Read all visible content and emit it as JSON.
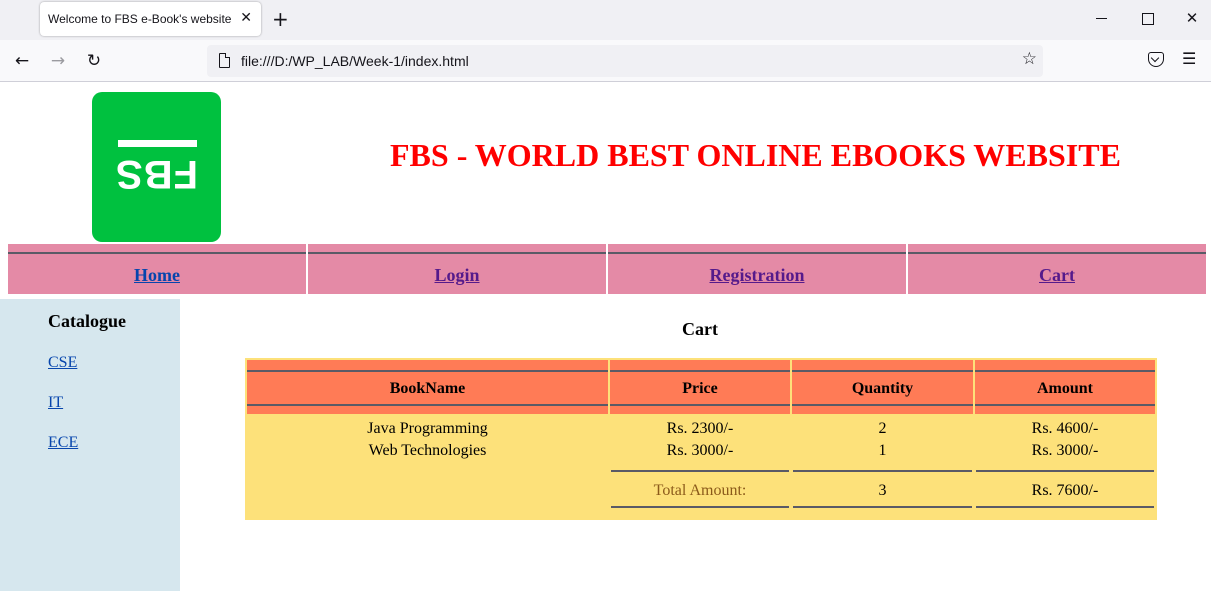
{
  "browser": {
    "tab_title": "Welcome to FBS e-Book's website",
    "tab_close": "✕",
    "new_tab": "+",
    "url": "file:///D:/WP_LAB/Week-1/index.html",
    "icons": {
      "back": "←",
      "forward": "→",
      "reload": "↻",
      "bookmark": "☆",
      "menu": "☰",
      "close_window": "✕"
    }
  },
  "header": {
    "logo_text": "FBS",
    "title": "FBS - WORLD BEST ONLINE EBOOKS WEBSITE",
    "title_color": "#ff0000",
    "logo_color": "#00c13f"
  },
  "nav": {
    "items": [
      {
        "label": "Home"
      },
      {
        "label": "Login"
      },
      {
        "label": "Registration"
      },
      {
        "label": "Cart"
      }
    ],
    "background": "#e48aa6"
  },
  "sidebar": {
    "title": "Catalogue",
    "links": [
      {
        "label": "CSE"
      },
      {
        "label": "IT"
      },
      {
        "label": "ECE"
      }
    ],
    "background": "#d6e7ee"
  },
  "cart": {
    "heading": "Cart",
    "columns": [
      "BookName",
      "Price",
      "Quantity",
      "Amount"
    ],
    "rows": [
      {
        "book": "Java Programming",
        "price": "Rs. 2300/-",
        "qty": "2",
        "amount": "Rs. 4600/-"
      },
      {
        "book": "Web Technologies",
        "price": "Rs. 3000/-",
        "qty": "1",
        "amount": "Rs. 3000/-"
      }
    ],
    "total": {
      "label": "Total Amount:",
      "qty": "3",
      "amount": "Rs. 7600/-"
    },
    "header_color": "#ff7b56",
    "body_color": "#fde17a"
  }
}
